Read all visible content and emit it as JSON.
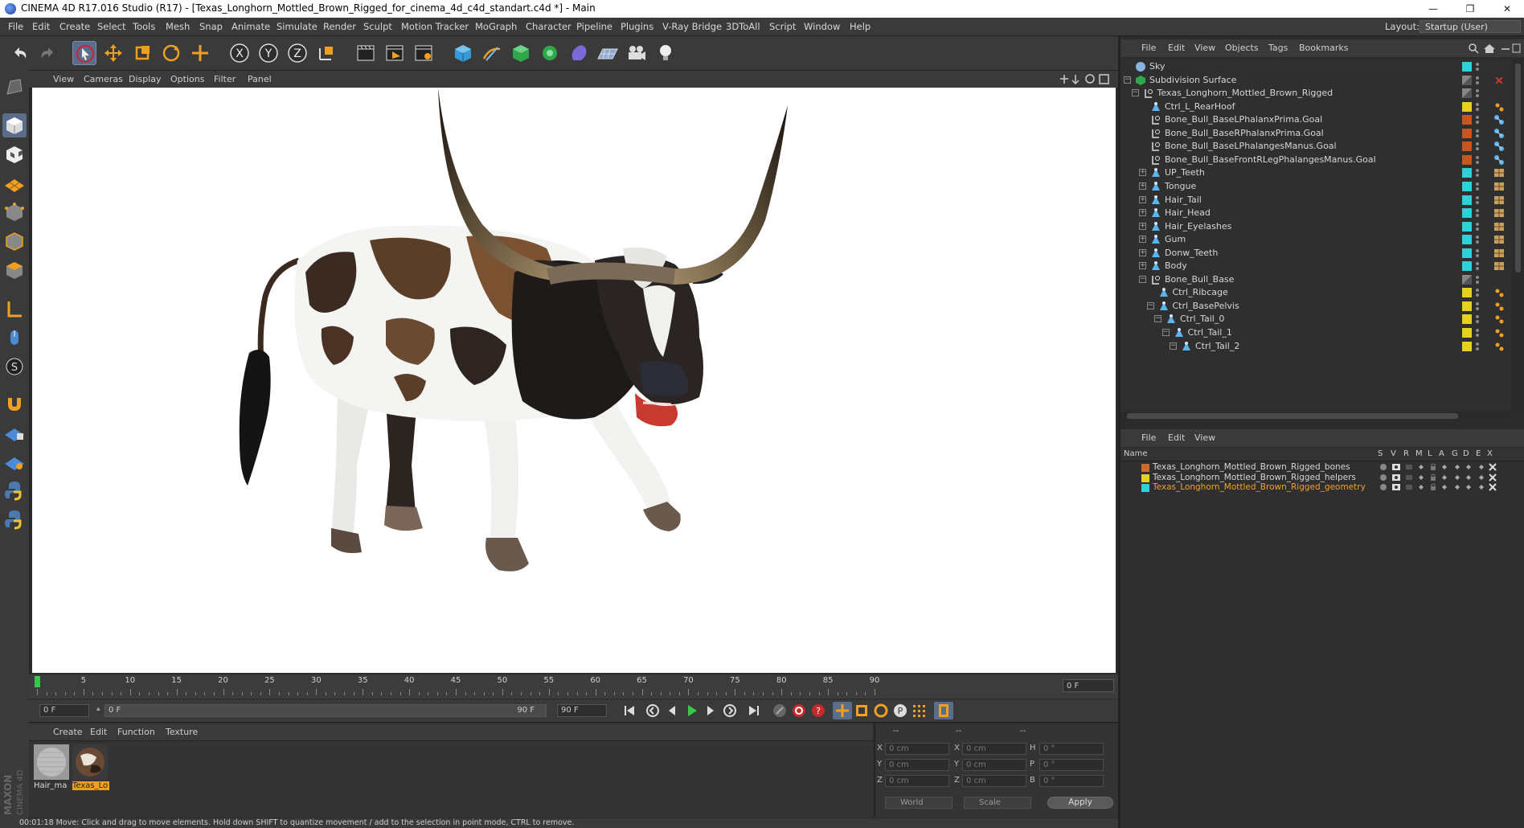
{
  "window": {
    "title": "CINEMA 4D R17.016 Studio (R17) - [Texas_Longhorn_Mottled_Brown_Rigged_for_cinema_4d_c4d_standart.c4d *] - Main",
    "minimize": "—",
    "restore": "❐",
    "close": "✕"
  },
  "menu": [
    "File",
    "Edit",
    "Create",
    "Select",
    "Tools",
    "Mesh",
    "Snap",
    "Animate",
    "Simulate",
    "Render",
    "Sculpt",
    "Motion Tracker",
    "MoGraph",
    "Character",
    "Pipeline",
    "Plugins",
    "V-Ray Bridge",
    "3DToAll",
    "Script",
    "Window",
    "Help"
  ],
  "layout": {
    "label": "Layout:",
    "value": "Startup (User)"
  },
  "viewport": {
    "menu": [
      "View",
      "Cameras",
      "Display",
      "Options",
      "Filter",
      "Panel"
    ]
  },
  "timeline": {
    "ticks": [
      "0",
      "5",
      "10",
      "15",
      "20",
      "25",
      "30",
      "35",
      "40",
      "45",
      "50",
      "55",
      "60",
      "65",
      "70",
      "75",
      "80",
      "85",
      "90"
    ],
    "current": "0 F"
  },
  "transport": {
    "start": "0 F",
    "range_start": "0 F",
    "range_end": "90 F",
    "end": "90 F"
  },
  "materials": {
    "menu": [
      "Create",
      "Edit",
      "Function",
      "Texture"
    ],
    "items": [
      {
        "name": "Hair_ma",
        "selected": false
      },
      {
        "name": "Texas_Lo",
        "selected": true
      }
    ]
  },
  "coordinates": {
    "header1": "--",
    "header2": "--",
    "header3": "--",
    "rows": [
      {
        "l1": "X",
        "v1": "0 cm",
        "l2": "X",
        "v2": "0 cm",
        "l3": "H",
        "v3": "0 °"
      },
      {
        "l1": "Y",
        "v1": "0 cm",
        "l2": "Y",
        "v2": "0 cm",
        "l3": "P",
        "v3": "0 °"
      },
      {
        "l1": "Z",
        "v1": "0 cm",
        "l2": "Z",
        "v2": "0 cm",
        "l3": "B",
        "v3": "0 °"
      }
    ],
    "world": "World",
    "scale": "Scale",
    "apply": "Apply"
  },
  "status": "00:01:18    Move: Click and drag to move elements. Hold down SHIFT to quantize movement / add to the selection in point mode, CTRL to remove.",
  "object_manager": {
    "menu": [
      "File",
      "Edit",
      "View",
      "Objects",
      "Tags",
      "Bookmarks"
    ],
    "objects": [
      {
        "name": "Sky",
        "indent": 0,
        "icon": "sky",
        "swatch": "#31d0d8",
        "exp": ""
      },
      {
        "name": "Subdivision Surface",
        "indent": 0,
        "icon": "subdiv",
        "swatch": "gray",
        "exp": "-"
      },
      {
        "name": "Texas_Longhorn_Mottled_Brown_Rigged",
        "indent": 1,
        "icon": "null",
        "swatch": "gray",
        "exp": "-"
      },
      {
        "name": "Ctrl_L_RearHoof",
        "indent": 2,
        "icon": "joint",
        "swatch": "#e6d21e",
        "exp": ""
      },
      {
        "name": "Bone_Bull_BaseLPhalanxPrima.Goal",
        "indent": 2,
        "icon": "null",
        "swatch": "#c8561e",
        "exp": ""
      },
      {
        "name": "Bone_Bull_BaseRPhalanxPrima.Goal",
        "indent": 2,
        "icon": "null",
        "swatch": "#c8561e",
        "exp": ""
      },
      {
        "name": "Bone_Bull_BaseLPhalangesManus.Goal",
        "indent": 2,
        "icon": "null",
        "swatch": "#c8561e",
        "exp": ""
      },
      {
        "name": "Bone_Bull_BaseFrontRLegPhalangesManus.Goal",
        "indent": 2,
        "icon": "null",
        "swatch": "#c8561e",
        "exp": ""
      },
      {
        "name": "UP_Teeth",
        "indent": 2,
        "icon": "joint",
        "swatch": "#31d0d8",
        "exp": "+"
      },
      {
        "name": "Tongue",
        "indent": 2,
        "icon": "joint",
        "swatch": "#31d0d8",
        "exp": "+"
      },
      {
        "name": "Hair_Tail",
        "indent": 2,
        "icon": "joint",
        "swatch": "#31d0d8",
        "exp": "+"
      },
      {
        "name": "Hair_Head",
        "indent": 2,
        "icon": "joint",
        "swatch": "#31d0d8",
        "exp": "+"
      },
      {
        "name": "Hair_Eyelashes",
        "indent": 2,
        "icon": "joint",
        "swatch": "#31d0d8",
        "exp": "+"
      },
      {
        "name": "Gum",
        "indent": 2,
        "icon": "joint",
        "swatch": "#31d0d8",
        "exp": "+"
      },
      {
        "name": "Donw_Teeth",
        "indent": 2,
        "icon": "joint",
        "swatch": "#31d0d8",
        "exp": "+"
      },
      {
        "name": "Body",
        "indent": 2,
        "icon": "joint",
        "swatch": "#31d0d8",
        "exp": "+"
      },
      {
        "name": "Bone_Bull_Base",
        "indent": 2,
        "icon": "null",
        "swatch": "gray",
        "exp": "-"
      },
      {
        "name": "Ctrl_Ribcage",
        "indent": 3,
        "icon": "joint",
        "swatch": "#e6d21e",
        "exp": ""
      },
      {
        "name": "Ctrl_BasePelvis",
        "indent": 3,
        "icon": "joint",
        "swatch": "#e6d21e",
        "exp": "-"
      },
      {
        "name": "Ctrl_Tail_0",
        "indent": 4,
        "icon": "joint",
        "swatch": "#e6d21e",
        "exp": "-"
      },
      {
        "name": "Ctrl_Tail_1",
        "indent": 5,
        "icon": "joint",
        "swatch": "#e6d21e",
        "exp": "-"
      },
      {
        "name": "Ctrl_Tail_2",
        "indent": 6,
        "icon": "joint",
        "swatch": "#e6d21e",
        "exp": "-"
      }
    ]
  },
  "layer_manager": {
    "menu": [
      "File",
      "Edit",
      "View"
    ],
    "columns": [
      "Name",
      "S",
      "V",
      "R",
      "M",
      "L",
      "A",
      "G",
      "D",
      "E",
      "X"
    ],
    "layers": [
      {
        "name": "Texas_Longhorn_Mottled_Brown_Rigged_bones",
        "color": "#d06a2a",
        "selected": false
      },
      {
        "name": "Texas_Longhorn_Mottled_Brown_Rigged_helpers",
        "color": "#e6d21e",
        "selected": false
      },
      {
        "name": "Texas_Longhorn_Mottled_Brown_Rigged_geometry",
        "color": "#31d0d8",
        "selected": true
      }
    ]
  }
}
